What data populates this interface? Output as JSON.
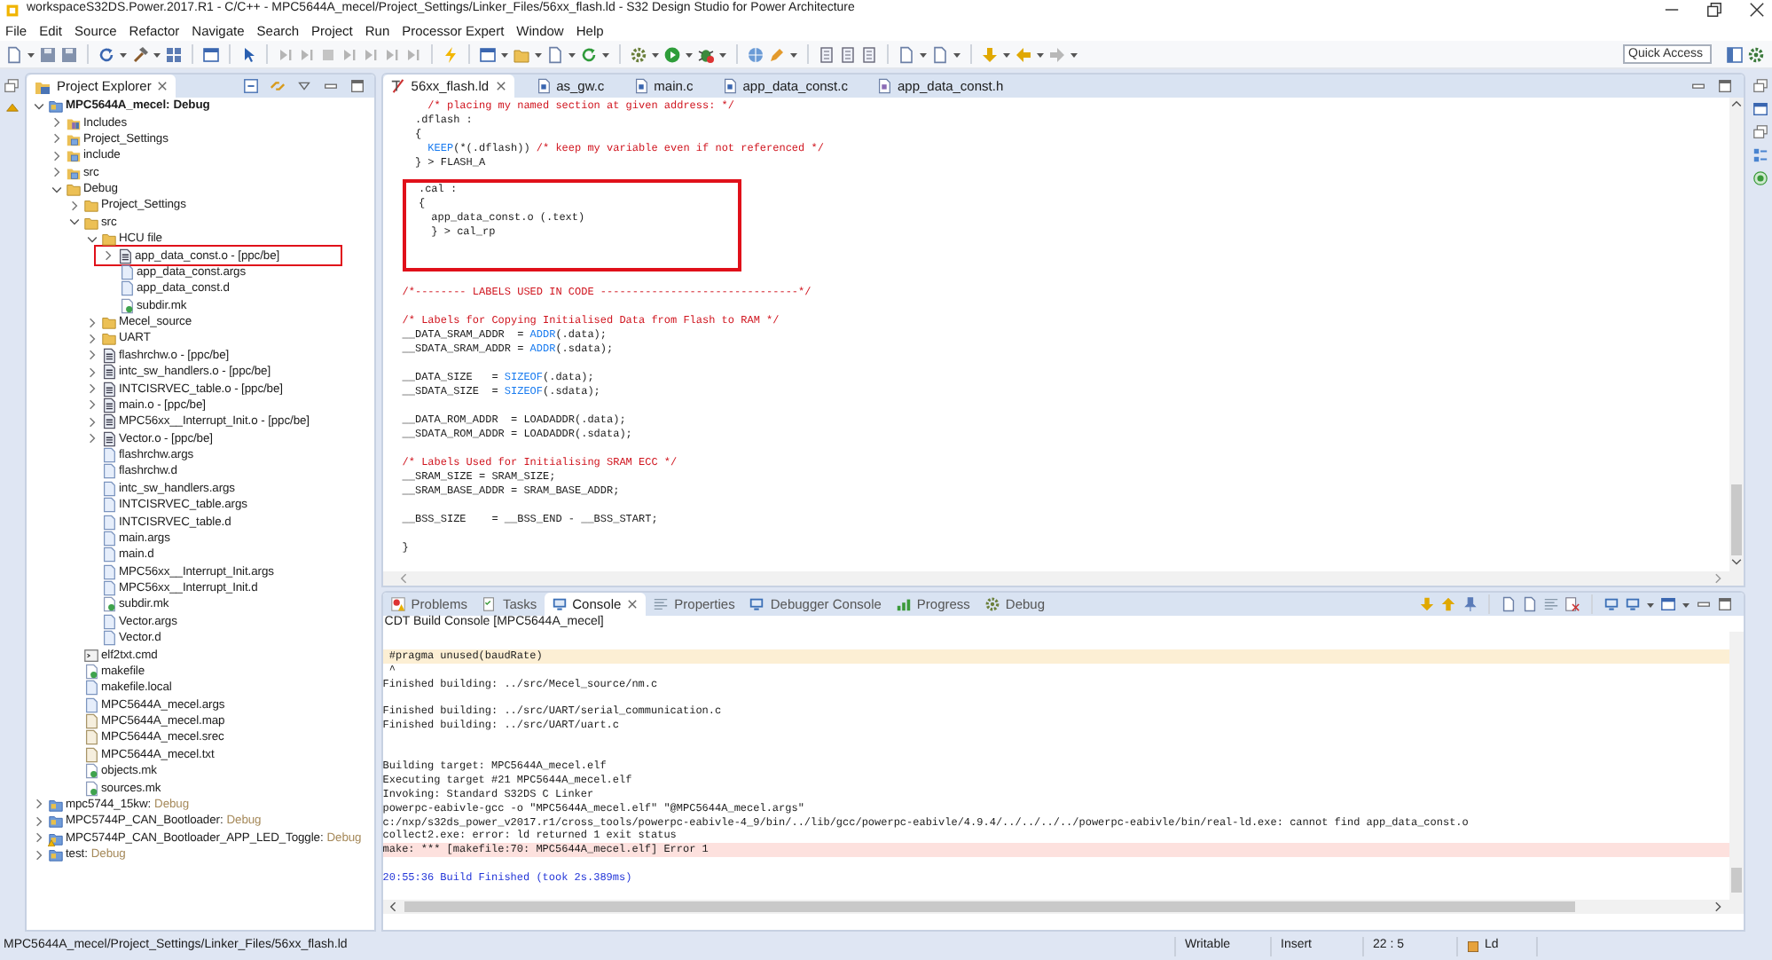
{
  "window": {
    "title": "workspaceS32DS.Power.2017.R1 - C/C++ - MPC5644A_mecel/Project_Settings/Linker_Files/56xx_flash.ld - S32 Design Studio for Power Architecture"
  },
  "menu": [
    "File",
    "Edit",
    "Source",
    "Refactor",
    "Navigate",
    "Search",
    "Project",
    "Run",
    "Processor Expert",
    "Window",
    "Help"
  ],
  "toolbar": {
    "quick_access": {
      "placeholder": "Quick Access"
    }
  },
  "explorer": {
    "title": "Project Explorer",
    "tree": [
      {
        "label": "MPC5644A_mecel:",
        "config": "Debug",
        "kind": "project",
        "active": true,
        "warning": false,
        "expanded": true,
        "children": [
          {
            "label": "Includes",
            "kind": "includes",
            "expanded": false
          },
          {
            "label": "Project_Settings",
            "kind": "source-folder",
            "expanded": false
          },
          {
            "label": "include",
            "kind": "source-folder",
            "expanded": false
          },
          {
            "label": "src",
            "kind": "source-folder",
            "expanded": false
          },
          {
            "label": "Debug",
            "kind": "folder",
            "expanded": true,
            "children": [
              {
                "label": "Project_Settings",
                "kind": "folder",
                "expanded": false
              },
              {
                "label": "src",
                "kind": "folder",
                "expanded": true,
                "children": [
                  {
                    "label": "HCU file",
                    "kind": "folder",
                    "expanded": true,
                    "children": [
                      {
                        "label": "app_data_const.o - [ppc/be]",
                        "kind": "object",
                        "expanded": false,
                        "annotated": true
                      },
                      {
                        "label": "app_data_const.args",
                        "kind": "file"
                      },
                      {
                        "label": "app_data_const.d",
                        "kind": "file"
                      },
                      {
                        "label": "subdir.mk",
                        "kind": "makefile"
                      }
                    ]
                  },
                  {
                    "label": "Mecel_source",
                    "kind": "folder",
                    "expanded": false
                  },
                  {
                    "label": "UART",
                    "kind": "folder",
                    "expanded": false
                  },
                  {
                    "label": "flashrchw.o - [ppc/be]",
                    "kind": "object",
                    "expanded": false
                  },
                  {
                    "label": "intc_sw_handlers.o - [ppc/be]",
                    "kind": "object",
                    "expanded": false
                  },
                  {
                    "label": "INTCISRVEC_table.o - [ppc/be]",
                    "kind": "object",
                    "expanded": false
                  },
                  {
                    "label": "main.o - [ppc/be]",
                    "kind": "object",
                    "expanded": false
                  },
                  {
                    "label": "MPC56xx__Interrupt_Init.o - [ppc/be]",
                    "kind": "object",
                    "expanded": false
                  },
                  {
                    "label": "Vector.o - [ppc/be]",
                    "kind": "object",
                    "expanded": false
                  },
                  {
                    "label": "flashrchw.args",
                    "kind": "file"
                  },
                  {
                    "label": "flashrchw.d",
                    "kind": "file"
                  },
                  {
                    "label": "intc_sw_handlers.args",
                    "kind": "file"
                  },
                  {
                    "label": "INTCISRVEC_table.args",
                    "kind": "file"
                  },
                  {
                    "label": "INTCISRVEC_table.d",
                    "kind": "file"
                  },
                  {
                    "label": "main.args",
                    "kind": "file"
                  },
                  {
                    "label": "main.d",
                    "kind": "file"
                  },
                  {
                    "label": "MPC56xx__Interrupt_Init.args",
                    "kind": "file"
                  },
                  {
                    "label": "MPC56xx__Interrupt_Init.d",
                    "kind": "file"
                  },
                  {
                    "label": "subdir.mk",
                    "kind": "makefile"
                  },
                  {
                    "label": "Vector.args",
                    "kind": "file"
                  },
                  {
                    "label": "Vector.d",
                    "kind": "file"
                  }
                ]
              },
              {
                "label": "elf2txt.cmd",
                "kind": "command"
              },
              {
                "label": "makefile",
                "kind": "makefile"
              },
              {
                "label": "makefile.local",
                "kind": "file"
              },
              {
                "label": "MPC5644A_mecel.args",
                "kind": "file"
              },
              {
                "label": "MPC5644A_mecel.map",
                "kind": "text"
              },
              {
                "label": "MPC5644A_mecel.srec",
                "kind": "text"
              },
              {
                "label": "MPC5644A_mecel.txt",
                "kind": "text"
              },
              {
                "label": "objects.mk",
                "kind": "makefile"
              },
              {
                "label": "sources.mk",
                "kind": "makefile"
              }
            ]
          }
        ]
      },
      {
        "label": "mpc5744_15kw:",
        "config": "Debug",
        "kind": "project",
        "active": false,
        "warning": false,
        "expanded": false
      },
      {
        "label": "MPC5744P_CAN_Bootloader:",
        "config": "Debug",
        "kind": "project",
        "active": false,
        "warning": false,
        "expanded": false
      },
      {
        "label": "MPC5744P_CAN_Bootloader_APP_LED_Toggle:",
        "config": "Debug",
        "kind": "project",
        "active": false,
        "warning": true,
        "expanded": false
      },
      {
        "label": "test:",
        "config": "Debug",
        "kind": "project",
        "active": false,
        "warning": false,
        "expanded": false
      }
    ]
  },
  "editor": {
    "tabs": [
      {
        "label": "56xx_flash.ld",
        "kind": "linker",
        "selected": true
      },
      {
        "label": "as_gw.c",
        "kind": "source",
        "selected": false
      },
      {
        "label": "main.c",
        "kind": "source",
        "selected": false
      },
      {
        "label": "app_data_const.c",
        "kind": "source",
        "selected": false
      },
      {
        "label": "app_data_const.h",
        "kind": "header",
        "selected": false
      }
    ],
    "blocks": [
      {
        "highlighted": false,
        "lines": [
          {
            "segments": [
              {
                "text": "    /* placing my named section at given address: */",
                "kind": "comment"
              }
            ]
          },
          {
            "segments": [
              {
                "text": "  .dflash :",
                "kind": "plain"
              }
            ]
          },
          {
            "segments": [
              {
                "text": "  {",
                "kind": "plain"
              }
            ]
          },
          {
            "segments": [
              {
                "text": "    KEEP",
                "kind": "keyword"
              },
              {
                "text": "(*(.dflash)) ",
                "kind": "plain"
              },
              {
                "text": "/* keep my variable even if not referenced */",
                "kind": "comment"
              }
            ]
          },
          {
            "segments": [
              {
                "text": "  } > FLASH_A",
                "kind": "plain"
              }
            ]
          },
          {
            "kind": "blank"
          }
        ]
      },
      {
        "highlighted": true,
        "lines": [
          {
            "segments": [
              {
                "text": "  .cal :",
                "kind": "plain"
              }
            ]
          },
          {
            "segments": [
              {
                "text": "  {",
                "kind": "plain"
              }
            ]
          },
          {
            "segments": [
              {
                "text": "    app_data_const.o (.text)",
                "kind": "plain"
              }
            ]
          },
          {
            "segments": [
              {
                "text": "    } > cal_rp",
                "kind": "plain"
              }
            ]
          },
          {
            "kind": "blank"
          }
        ]
      },
      {
        "highlighted": false,
        "lines": [
          {
            "kind": "blank"
          },
          {
            "segments": [
              {
                "text": "/*-------- LABELS USED IN CODE -------------------------------*/",
                "kind": "comment"
              }
            ]
          },
          {
            "kind": "blank"
          },
          {
            "segments": [
              {
                "text": "/* Labels for Copying Initialised Data from Flash to RAM */",
                "kind": "comment"
              }
            ]
          },
          {
            "segments": [
              {
                "text": "__DATA_SRAM_ADDR  = ",
                "kind": "plain"
              },
              {
                "text": "ADDR",
                "kind": "keyword"
              },
              {
                "text": "(.data);",
                "kind": "plain"
              }
            ]
          },
          {
            "segments": [
              {
                "text": "__SDATA_SRAM_ADDR = ",
                "kind": "plain"
              },
              {
                "text": "ADDR",
                "kind": "keyword"
              },
              {
                "text": "(.sdata);",
                "kind": "plain"
              }
            ]
          },
          {
            "kind": "blank"
          },
          {
            "segments": [
              {
                "text": "__DATA_SIZE   = ",
                "kind": "plain"
              },
              {
                "text": "SIZEOF",
                "kind": "keyword"
              },
              {
                "text": "(.data);",
                "kind": "plain"
              }
            ]
          },
          {
            "segments": [
              {
                "text": "__SDATA_SIZE  = ",
                "kind": "plain"
              },
              {
                "text": "SIZEOF",
                "kind": "keyword"
              },
              {
                "text": "(.sdata);",
                "kind": "plain"
              }
            ]
          },
          {
            "kind": "blank"
          },
          {
            "segments": [
              {
                "text": "__DATA_ROM_ADDR  = LOADADDR(.data);",
                "kind": "plain"
              }
            ]
          },
          {
            "segments": [
              {
                "text": "__SDATA_ROM_ADDR = LOADADDR(.sdata);",
                "kind": "plain"
              }
            ]
          },
          {
            "kind": "blank"
          },
          {
            "segments": [
              {
                "text": "/* Labels Used for Initialising SRAM ECC */",
                "kind": "comment"
              }
            ]
          },
          {
            "segments": [
              {
                "text": "__SRAM_SIZE = SRAM_SIZE;",
                "kind": "plain"
              }
            ]
          },
          {
            "segments": [
              {
                "text": "__SRAM_BASE_ADDR = SRAM_BASE_ADDR;",
                "kind": "plain"
              }
            ]
          },
          {
            "kind": "blank"
          },
          {
            "segments": [
              {
                "text": "__BSS_SIZE    = __BSS_END - __BSS_START;",
                "kind": "plain"
              }
            ]
          },
          {
            "kind": "blank"
          },
          {
            "segments": [
              {
                "text": "}",
                "kind": "plain"
              }
            ]
          }
        ]
      }
    ]
  },
  "console": {
    "tabs": [
      {
        "label": "Problems",
        "kind": "problems",
        "selected": false
      },
      {
        "label": "Tasks",
        "kind": "tasks",
        "selected": false
      },
      {
        "label": "Console",
        "kind": "console",
        "selected": true
      },
      {
        "label": "Properties",
        "kind": "properties",
        "selected": false
      },
      {
        "label": "Debugger Console",
        "kind": "console",
        "selected": false
      },
      {
        "label": "Progress",
        "kind": "progress",
        "selected": false
      },
      {
        "label": "Debug",
        "kind": "debug",
        "selected": false
      }
    ],
    "title": "CDT Build Console [MPC5644A_mecel]",
    "lines": [
      {
        "text": " #pragma unused(baudRate)",
        "kind": "warning"
      },
      {
        "text": " ^",
        "kind": "plain"
      },
      {
        "text": "Finished building: ../src/Mecel_source/nm.c",
        "kind": "plain"
      },
      {
        "kind": "blank"
      },
      {
        "text": "Finished building: ../src/UART/serial_communication.c",
        "kind": "plain"
      },
      {
        "text": "Finished building: ../src/UART/uart.c",
        "kind": "plain"
      },
      {
        "kind": "blank"
      },
      {
        "kind": "blank"
      },
      {
        "text": "Building target: MPC5644A_mecel.elf",
        "kind": "plain"
      },
      {
        "text": "Executing target #21 MPC5644A_mecel.elf",
        "kind": "plain"
      },
      {
        "text": "Invoking: Standard S32DS C Linker",
        "kind": "plain"
      },
      {
        "text": "powerpc-eabivle-gcc -o \"MPC5644A_mecel.elf\" \"@MPC5644A_mecel.args\"",
        "kind": "plain"
      },
      {
        "text": "c:/nxp/s32ds_power_v2017.r1/cross_tools/powerpc-eabivle-4_9/bin/../lib/gcc/powerpc-eabivle/4.9.4/../../../../powerpc-eabivle/bin/real-ld.exe: cannot find app_data_const.o",
        "kind": "plain"
      },
      {
        "text": "collect2.exe: error: ld returned 1 exit status",
        "kind": "plain"
      },
      {
        "text": "make: *** [makefile:70: MPC5644A_mecel.elf] Error 1",
        "kind": "error"
      },
      {
        "kind": "blank"
      },
      {
        "text": "20:55:36 Build Finished (took 2s.389ms)",
        "kind": "info"
      }
    ]
  },
  "status_bar": {
    "path": "MPC5644A_mecel/Project_Settings/Linker_Files/56xx_flash.ld",
    "items": [
      {
        "text": "Writable",
        "kind": "plain"
      },
      {
        "text": "Insert",
        "kind": "plain"
      },
      {
        "text": "22 : 5",
        "kind": "plain"
      },
      {
        "text": "Ld",
        "kind": "file-type"
      }
    ]
  }
}
